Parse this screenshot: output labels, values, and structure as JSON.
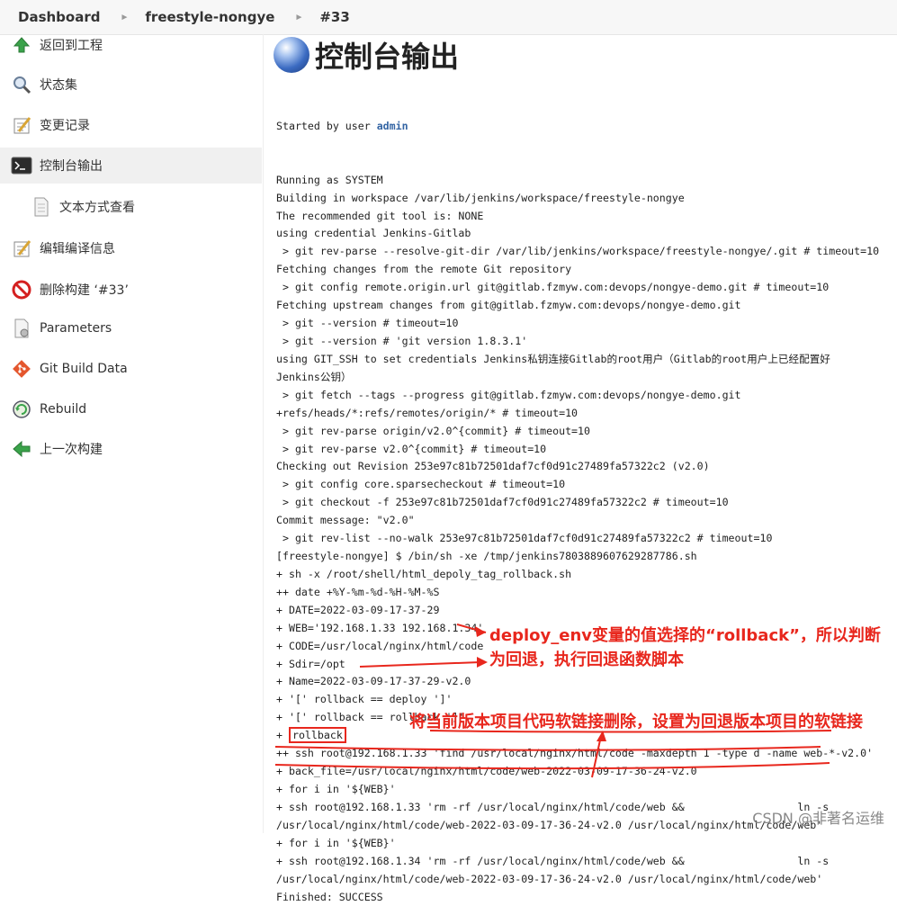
{
  "breadcrumb": {
    "items": [
      "Dashboard",
      "freestyle-nongye",
      "#33"
    ]
  },
  "sidebar": {
    "items": [
      {
        "label": "返回到工程",
        "icon": "up-arrow-icon"
      },
      {
        "label": "状态集",
        "icon": "magnifier-icon"
      },
      {
        "label": "变更记录",
        "icon": "notepad-icon"
      },
      {
        "label": "控制台输出",
        "icon": "terminal-icon"
      },
      {
        "label": "文本方式查看",
        "icon": "document-icon"
      },
      {
        "label": "编辑编译信息",
        "icon": "notepad-icon"
      },
      {
        "label": "删除构建 ‘#33’",
        "icon": "no-entry-icon"
      },
      {
        "label": "Parameters",
        "icon": "parameters-icon"
      },
      {
        "label": "Git Build Data",
        "icon": "git-icon"
      },
      {
        "label": "Rebuild",
        "icon": "rebuild-icon"
      },
      {
        "label": "上一次构建",
        "icon": "left-arrow-icon"
      }
    ]
  },
  "main": {
    "title": "控制台输出",
    "started_prefix": "Started by user ",
    "started_user": "admin",
    "rollback_word": "rollback",
    "console_lines": [
      "Running as SYSTEM",
      "Building in workspace /var/lib/jenkins/workspace/freestyle-nongye",
      "The recommended git tool is: NONE",
      "using credential Jenkins-Gitlab",
      " > git rev-parse --resolve-git-dir /var/lib/jenkins/workspace/freestyle-nongye/.git # timeout=10",
      "Fetching changes from the remote Git repository",
      " > git config remote.origin.url git@gitlab.fzmyw.com:devops/nongye-demo.git # timeout=10",
      "Fetching upstream changes from git@gitlab.fzmyw.com:devops/nongye-demo.git",
      " > git --version # timeout=10",
      " > git --version # 'git version 1.8.3.1'",
      "using GIT_SSH to set credentials Jenkins私钥连接Gitlab的root用户（Gitlab的root用户上已经配置好",
      "Jenkins公钥）",
      " > git fetch --tags --progress git@gitlab.fzmyw.com:devops/nongye-demo.git",
      "+refs/heads/*:refs/remotes/origin/* # timeout=10",
      " > git rev-parse origin/v2.0^{commit} # timeout=10",
      " > git rev-parse v2.0^{commit} # timeout=10",
      "Checking out Revision 253e97c81b72501daf7cf0d91c27489fa57322c2 (v2.0)",
      " > git config core.sparsecheckout # timeout=10",
      " > git checkout -f 253e97c81b72501daf7cf0d91c27489fa57322c2 # timeout=10",
      "Commit message: \"v2.0\"",
      " > git rev-list --no-walk 253e97c81b72501daf7cf0d91c27489fa57322c2 # timeout=10",
      "[freestyle-nongye] $ /bin/sh -xe /tmp/jenkins7803889607629287786.sh",
      "+ sh -x /root/shell/html_depoly_tag_rollback.sh",
      "++ date +%Y-%m-%d-%H-%M-%S",
      "+ DATE=2022-03-09-17-37-29",
      "+ WEB='192.168.1.33 192.168.1.34'",
      "+ CODE=/usr/local/nginx/html/code",
      "+ Sdir=/opt",
      "+ Name=2022-03-09-17-37-29-v2.0",
      "+ '[' rollback == deploy ']'",
      "+ '[' rollback == rollback ']'",
      "+ ",
      "++ ssh root@192.168.1.33 'find /usr/local/nginx/html/code -maxdepth 1 -type d -name web-*-v2.0'",
      "+ back_file=/usr/local/nginx/html/code/web-2022-03-09-17-36-24-v2.0",
      "+ for i in '${WEB}'",
      "+ ssh root@192.168.1.33 'rm -rf /usr/local/nginx/html/code/web &&                  ln -s",
      "/usr/local/nginx/html/code/web-2022-03-09-17-36-24-v2.0 /usr/local/nginx/html/code/web'",
      "+ for i in '${WEB}'",
      "+ ssh root@192.168.1.34 'rm -rf /usr/local/nginx/html/code/web &&                  ln -s",
      "/usr/local/nginx/html/code/web-2022-03-09-17-36-24-v2.0 /usr/local/nginx/html/code/web'",
      "Finished: SUCCESS"
    ]
  },
  "annotations": {
    "note1_line1": "deploy_env变量的值选择的“rollback”，所以判断",
    "note1_line2": "为回退，执行回退函数脚本",
    "note2": "将当前版本项目代码软链接删除，设置为回退版本项目的软链接",
    "color": "#e8271d"
  },
  "watermark": "CSDN @非著名运维"
}
